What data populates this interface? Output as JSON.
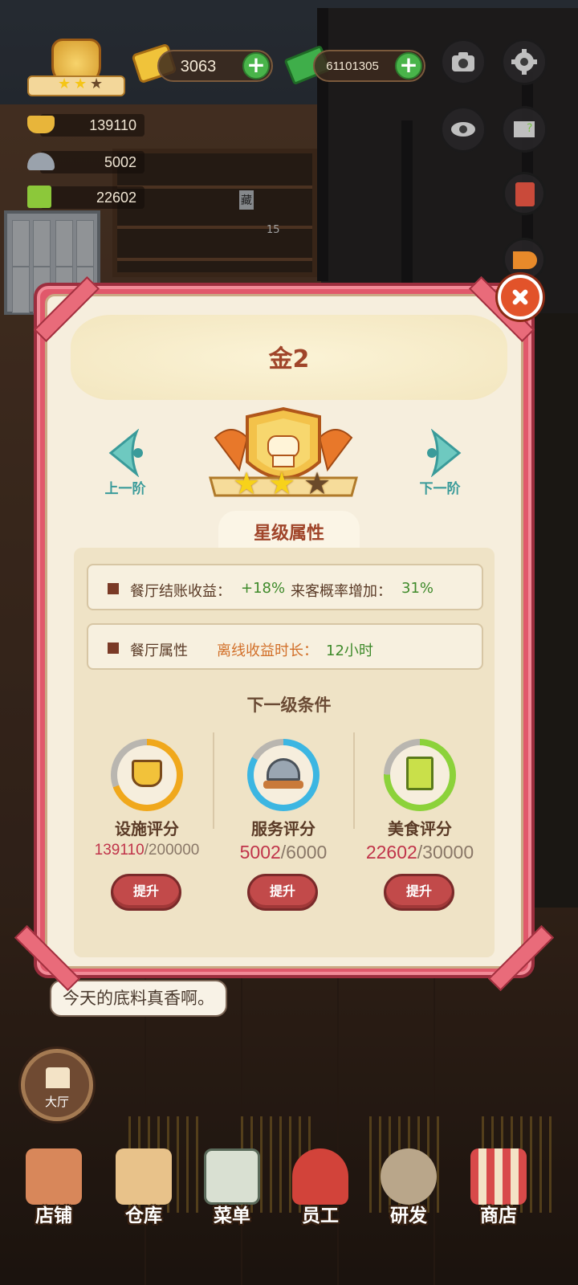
{
  "hud": {
    "gold": "3063",
    "cash": "61101305"
  },
  "stats": {
    "facility": "139110",
    "service": "5002",
    "food": "22602"
  },
  "scene_text": {
    "speech": "今天的底料真香啊。",
    "shelf_tag": "藏",
    "shelf_num": "15"
  },
  "modal": {
    "title": "金2",
    "prev_label": "上一阶",
    "next_label": "下一阶",
    "stars_filled": 2,
    "stars_total": 3,
    "section_attr": "星级属性",
    "attr1": {
      "label1": "餐厅结账收益：",
      "value1": "+18%",
      "label2": "来客概率增加：",
      "value2": "31%"
    },
    "attr2": {
      "label": "餐厅属性",
      "key": "离线收益时长：",
      "value": "12小时"
    },
    "section_next": "下一级条件",
    "conditions": [
      {
        "label": "设施评分",
        "current": "139110",
        "total": "/200000",
        "button": "提升",
        "ring_color": "#f0a81c",
        "progress": 0.6956
      },
      {
        "label": "服务评分",
        "current": "5002",
        "total": "/6000",
        "button": "提升",
        "ring_color": "#3cb6e2",
        "progress": 0.8337
      },
      {
        "label": "美食评分",
        "current": "22602",
        "total": "/30000",
        "button": "提升",
        "ring_color": "#8cd23a",
        "progress": 0.7534
      }
    ]
  },
  "nav": {
    "hall": "大厅",
    "items": [
      "店铺",
      "仓库",
      "菜单",
      "员工",
      "研发",
      "商店"
    ]
  },
  "colors": {
    "modal_frame": "#e1586b",
    "title": "#a0452a",
    "arrow": "#3a9b9a",
    "upgrade_button": "#c24a4a"
  }
}
